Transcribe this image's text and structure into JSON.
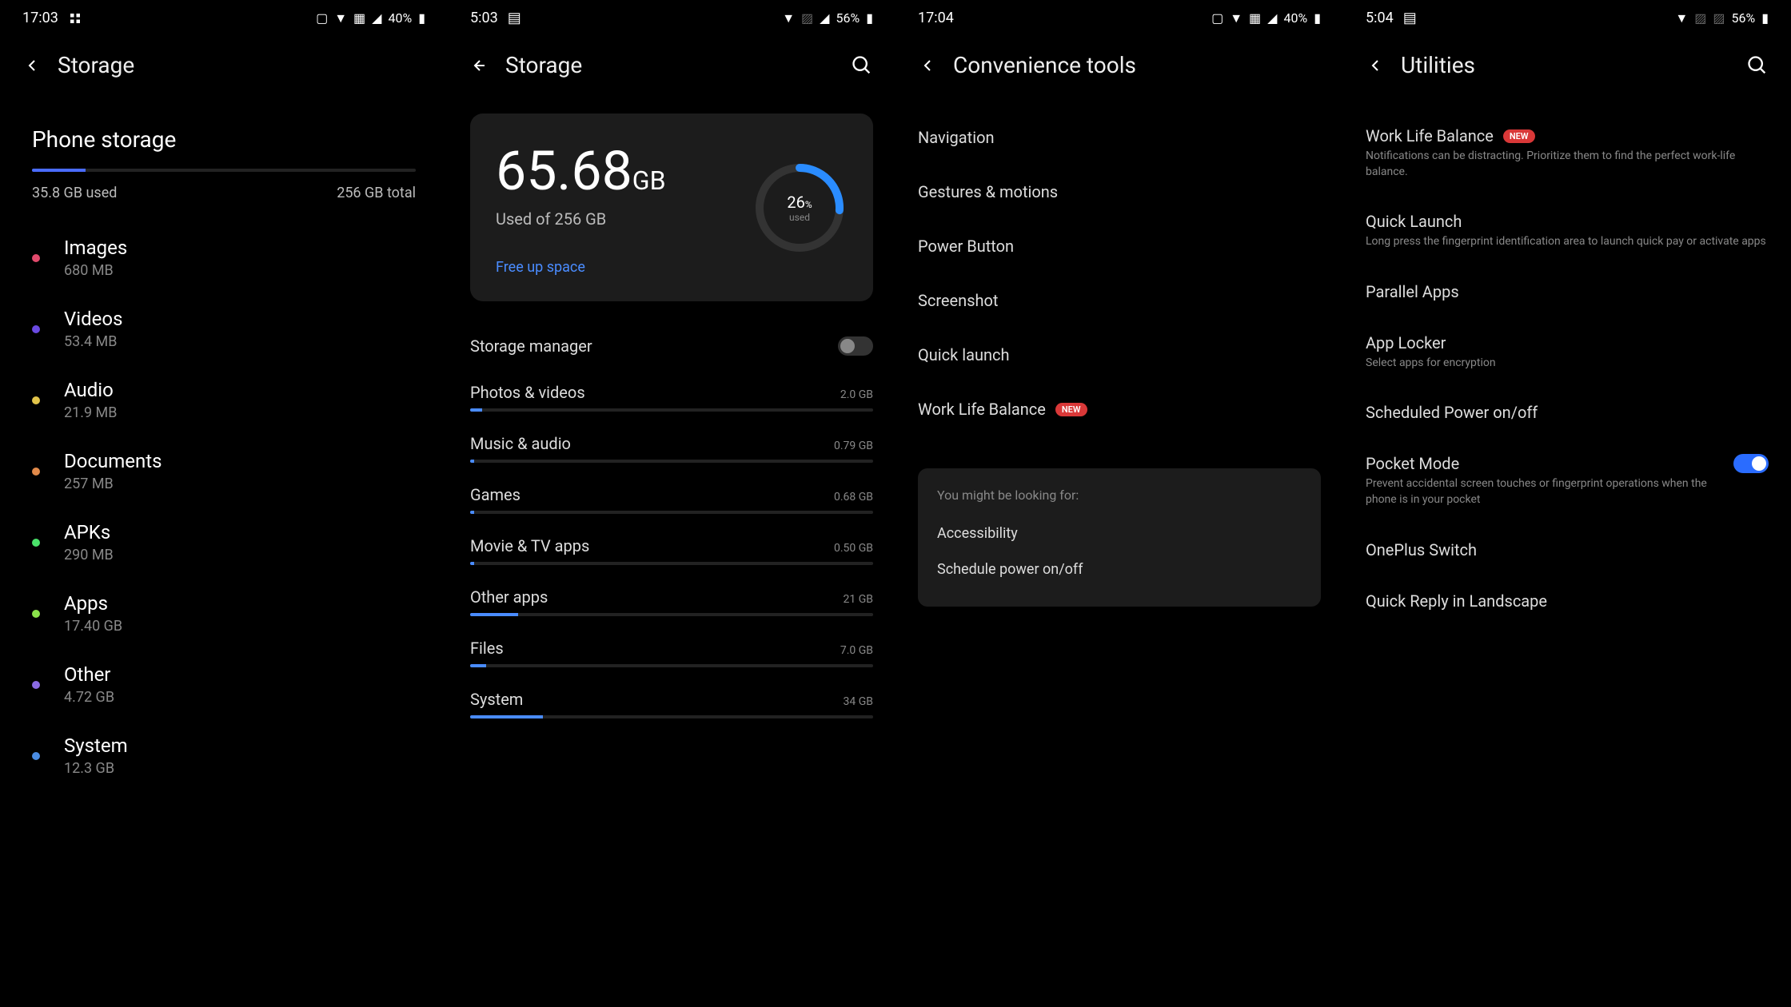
{
  "panel1": {
    "status": {
      "time": "17:03",
      "battery": "40%"
    },
    "title": "Storage",
    "section": "Phone storage",
    "used": "35.8 GB used",
    "total": "256 GB total",
    "items": [
      {
        "name": "Images",
        "size": "680 MB",
        "color": "#e24a6c"
      },
      {
        "name": "Videos",
        "size": "53.4 MB",
        "color": "#6a4ae2"
      },
      {
        "name": "Audio",
        "size": "21.9 MB",
        "color": "#e2c44a"
      },
      {
        "name": "Documents",
        "size": "257 MB",
        "color": "#e28a4a"
      },
      {
        "name": "APKs",
        "size": "290 MB",
        "color": "#4ae26a"
      },
      {
        "name": "Apps",
        "size": "17.40  GB",
        "color": "#8ae24a"
      },
      {
        "name": "Other",
        "size": "4.72 GB",
        "color": "#8a6ae2"
      },
      {
        "name": "System",
        "size": "12.3 GB",
        "color": "#4a8ce2"
      }
    ]
  },
  "panel2": {
    "status": {
      "time": "5:03",
      "battery": "56%"
    },
    "title": "Storage",
    "usedNum": "65.68",
    "usedUnit": "GB",
    "usedOf": "Used of 256 GB",
    "freeUp": "Free up space",
    "percent": "26",
    "percentLabel": "used",
    "toggleLabel": "Storage manager",
    "toggleOn": false,
    "categories": [
      {
        "name": "Photos & videos",
        "size": "2.0 GB",
        "fill": 3
      },
      {
        "name": "Music & audio",
        "size": "0.79 GB",
        "fill": 1
      },
      {
        "name": "Games",
        "size": "0.68 GB",
        "fill": 1
      },
      {
        "name": "Movie & TV apps",
        "size": "0.50 GB",
        "fill": 1
      },
      {
        "name": "Other apps",
        "size": "21 GB",
        "fill": 12
      },
      {
        "name": "Files",
        "size": "7.0 GB",
        "fill": 4
      },
      {
        "name": "System",
        "size": "34 GB",
        "fill": 18
      }
    ]
  },
  "panel3": {
    "status": {
      "time": "17:04",
      "battery": "40%"
    },
    "title": "Convenience tools",
    "items": [
      {
        "label": "Navigation",
        "new": false
      },
      {
        "label": "Gestures & motions",
        "new": false
      },
      {
        "label": "Power Button",
        "new": false
      },
      {
        "label": "Screenshot",
        "new": false
      },
      {
        "label": "Quick launch",
        "new": false
      },
      {
        "label": "Work Life Balance",
        "new": true
      }
    ],
    "suggestion": {
      "title": "You might be looking for:",
      "items": [
        "Accessibility",
        "Schedule power on/off"
      ]
    },
    "newBadge": "NEW"
  },
  "panel4": {
    "status": {
      "time": "5:04",
      "battery": "56%"
    },
    "title": "Utilities",
    "newBadge": "NEW",
    "items": [
      {
        "title": "Work Life Balance",
        "desc": "Notifications can be distracting. Prioritize them to find the perfect work-life balance.",
        "new": true,
        "toggle": null
      },
      {
        "title": "Quick Launch",
        "desc": "Long press the fingerprint identification area to launch quick pay or activate apps",
        "new": false,
        "toggle": null
      },
      {
        "title": "Parallel Apps",
        "desc": "",
        "new": false,
        "toggle": null
      },
      {
        "title": "App Locker",
        "desc": "Select apps for encryption",
        "new": false,
        "toggle": null
      },
      {
        "title": "Scheduled Power on/off",
        "desc": "",
        "new": false,
        "toggle": null
      },
      {
        "title": "Pocket Mode",
        "desc": "Prevent accidental screen touches or fingerprint operations when the phone is in your pocket",
        "new": false,
        "toggle": true
      },
      {
        "title": "OnePlus Switch",
        "desc": "",
        "new": false,
        "toggle": null
      },
      {
        "title": "Quick Reply in Landscape",
        "desc": "",
        "new": false,
        "toggle": null
      }
    ]
  }
}
